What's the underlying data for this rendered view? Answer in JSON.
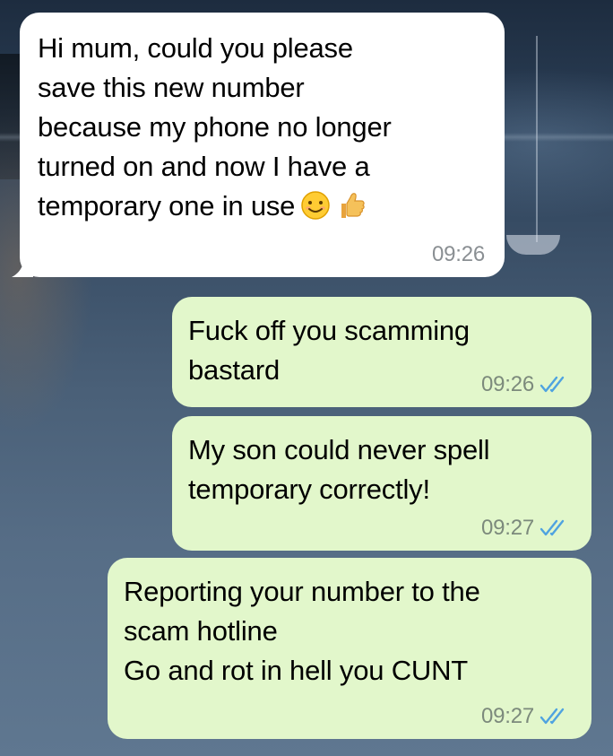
{
  "messages": [
    {
      "direction": "incoming",
      "text": "Hi mum, could you please\nsave this new number\nbecause my phone no longer\nturned on and now I have a\ntemporary one in use",
      "emojis": [
        "smiling-face-emoji",
        "thumbs-up-emoji"
      ],
      "time": "09:26"
    },
    {
      "direction": "outgoing",
      "text": "Fuck off you scamming\nbastard",
      "time": "09:26",
      "status": "read"
    },
    {
      "direction": "outgoing",
      "text": "My son could never spell\ntemporary correctly!",
      "time": "09:27",
      "status": "read"
    },
    {
      "direction": "outgoing",
      "text": "Reporting your number to the\nscam hotline\nGo and rot in hell you CUNT",
      "time": "09:27",
      "status": "read"
    }
  ],
  "colors": {
    "incoming_bubble": "#ffffff",
    "outgoing_bubble": "#e2f7cb",
    "read_ticks": "#4fa3e0",
    "timestamp": "#8a8f93"
  },
  "icons": {
    "read_receipt": "double-check-icon"
  }
}
